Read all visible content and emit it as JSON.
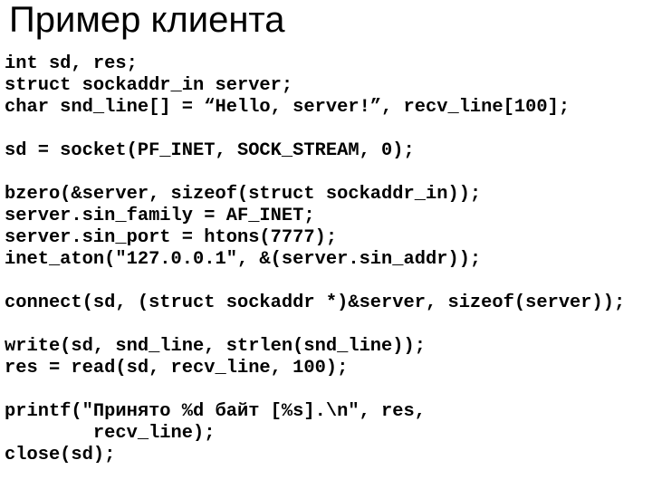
{
  "slide": {
    "title": "Пример клиента",
    "background_color": "#ffffff",
    "text_color": "#000000",
    "code_lines": [
      "int sd, res;",
      "struct sockaddr_in server;",
      "char snd_line[] = “Hello, server!”, recv_line[100];",
      "",
      "sd = socket(PF_INET, SOCK_STREAM, 0);",
      "",
      "bzero(&server, sizeof(struct sockaddr_in));",
      "server.sin_family = AF_INET;",
      "server.sin_port = htons(7777);",
      "inet_aton(\"127.0.0.1\", &(server.sin_addr));",
      "",
      "connect(sd, (struct sockaddr *)&server, sizeof(server));",
      "",
      "write(sd, snd_line, strlen(snd_line));",
      "res = read(sd, recv_line, 100);",
      "",
      "printf(\"Принято %d байт [%s].\\n\", res,",
      "        recv_line);",
      "close(sd);"
    ]
  }
}
